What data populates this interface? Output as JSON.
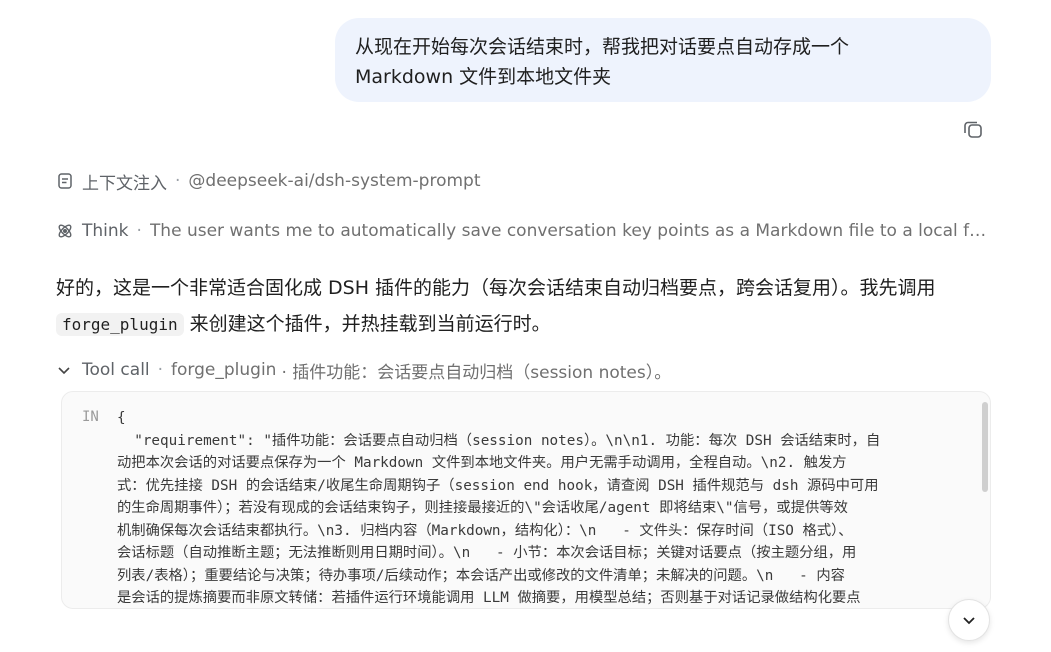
{
  "user_message": {
    "lines": [
      "从现在开始每次会话结束时，帮我把对话要点自动存成一个",
      "Markdown 文件到本地文件夹"
    ]
  },
  "context_row": {
    "label": "上下文注入",
    "separator": "·",
    "value": "@deepseek-ai/dsh-system-prompt",
    "icon": "document-icon"
  },
  "think_row": {
    "label": "Think",
    "separator": "·",
    "text": "The user wants me to automatically save conversation key points as a Markdown file to a local folder at the end of each session.",
    "icon": "think-icon"
  },
  "answer": {
    "line1": "好的，这是一个非常适合固化成 DSH 插件的能力（每次会话结束自动归档要点，跨会话复用）。我先调用",
    "code": "forge_plugin",
    "line2_rest": " 来创建这个插件，并热挂载到当前运行时。"
  },
  "tool_call": {
    "label": "Tool call",
    "separator": "·",
    "name": "forge_plugin",
    "desc": "· 插件功能：会话要点自动归档（session notes）。",
    "in_label": "IN",
    "code_lines": [
      "{",
      "  \"requirement\": \"插件功能：会话要点自动归档（session notes）。\\n\\n1. 功能：每次 DSH 会话结束时，自",
      "动把本次会话的对话要点保存为一个 Markdown 文件到本地文件夹。用户无需手动调用，全程自动。\\n2. 触发方",
      "式：优先挂接 DSH 的会话结束/收尾生命周期钩子（session end hook，请查阅 DSH 插件规范与 dsh 源码中可用",
      "的生命周期事件）；若没有现成的会话结束钩子，则挂接最接近的\\\"会话收尾/agent 即将结束\\\"信号，或提供等效",
      "机制确保每次会话结束都执行。\\n3. 归档内容（Markdown，结构化）：\\n   - 文件头：保存时间（ISO 格式）、",
      "会话标题（自动推断主题；无法推断则用日期时间）。\\n   - 小节：本次会话目标；关键对话要点（按主题分组，用",
      "列表/表格）；重要结论与决策；待办事项/后续动作；本会话产出或修改的文件清单；未解决的问题。\\n   - 内容",
      "是会话的提炼摘要而非原文转储：若插件运行环境能调用 LLM 做摘要，用模型总结；否则基于对话记录做结构化要点"
    ]
  }
}
